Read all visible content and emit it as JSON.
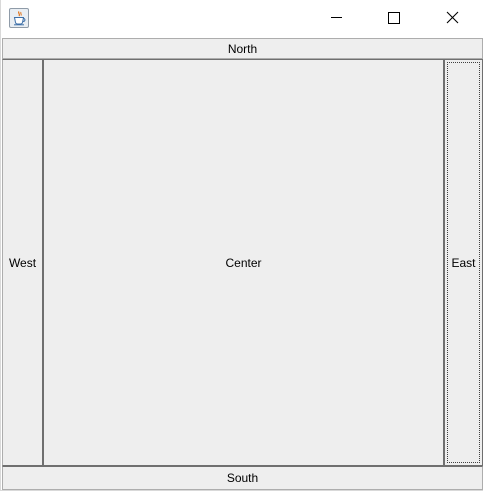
{
  "window": {
    "title": "",
    "icon": "java-coffee-cup-icon",
    "controls": {
      "minimize_icon": "minimize-icon",
      "maximize_icon": "maximize-icon",
      "close_icon": "close-icon"
    }
  },
  "layout": {
    "north_label": "North",
    "west_label": "West",
    "center_label": "Center",
    "east_label": "East",
    "south_label": "South"
  },
  "colors": {
    "panel_background": "#eeeeee",
    "titlebar_background": "#ffffff"
  }
}
